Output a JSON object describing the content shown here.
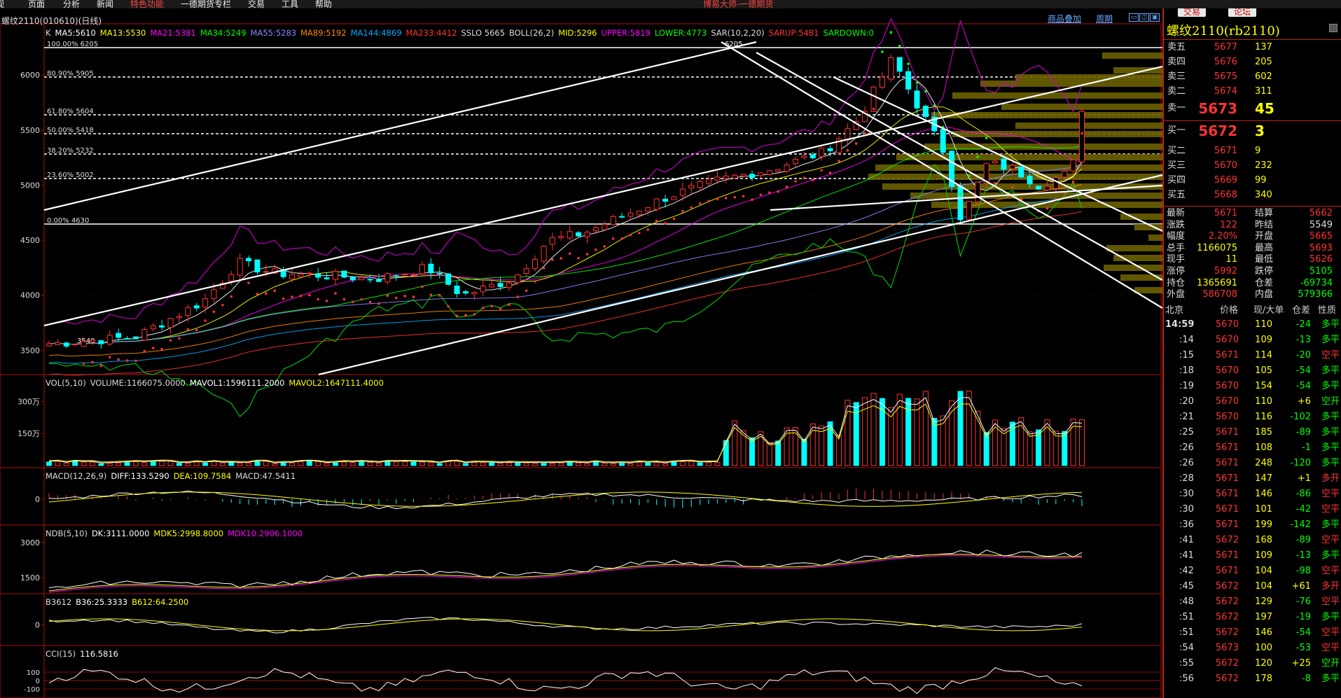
{
  "menu": {
    "items": [
      "视",
      "页面",
      "分析",
      "新闻",
      "特色功能",
      "一德期货专栏",
      "交易",
      "工具",
      "帮助"
    ],
    "app_title": "博易大师-一德期货"
  },
  "chart": {
    "symbol_title": "螺纹2110(010610)(日线)",
    "links": [
      "商品叠加",
      "周期"
    ],
    "main_indicators": [
      {
        "t": "K",
        "c": "#ddd"
      },
      {
        "t": "MA5:5610",
        "c": "#fff"
      },
      {
        "t": "MA13:5530",
        "c": "#ff0"
      },
      {
        "t": "MA21:5381",
        "c": "#f0f"
      },
      {
        "t": "MA34:5249",
        "c": "#0f0"
      },
      {
        "t": "MA55:5283",
        "c": "#88f"
      },
      {
        "t": "MA89:5192",
        "c": "#f80"
      },
      {
        "t": "MA144:4869",
        "c": "#0af"
      },
      {
        "t": "MA233:4412",
        "c": "#f33"
      },
      {
        "t": "SSLO 5665",
        "c": "#ddd"
      },
      {
        "t": "BOLL(26,2)",
        "c": "#ddd"
      },
      {
        "t": "MID:5296",
        "c": "#ff0"
      },
      {
        "t": "UPPER:5819",
        "c": "#f0f"
      },
      {
        "t": "LOWER:4773",
        "c": "#0f0"
      },
      {
        "t": "SAR(10,2,20)",
        "c": "#ddd"
      },
      {
        "t": "SARUP:5481",
        "c": "#f33"
      },
      {
        "t": "SARDOWN:0",
        "c": "#0f0"
      }
    ],
    "main_y_ticks": [
      "6000",
      "5500",
      "5000",
      "4500",
      "4000",
      "3500"
    ],
    "fib_labels": [
      "100.00% 6205",
      "80.90% 5905",
      "61.80% 5604",
      "50.00% 5418",
      "38.20% 5232",
      "23.60% 5002",
      "0.00% 4630"
    ],
    "peak_label": "6205",
    "low_label": "3540",
    "vol": {
      "title": "VOL(5,10)",
      "items": [
        {
          "t": "VOLUME:1166075.0000",
          "c": "#ddd"
        },
        {
          "t": "MAVOL1:1596111.2000",
          "c": "#fff"
        },
        {
          "t": "MAVOL2:1647111.4000",
          "c": "#ff0"
        }
      ],
      "ticks": [
        "300万",
        "150万"
      ]
    },
    "macd": {
      "title": "MACD(12,26,9)",
      "items": [
        {
          "t": "DIFF:133.5290",
          "c": "#fff"
        },
        {
          "t": "DEA:109.7584",
          "c": "#ff0"
        },
        {
          "t": "MACD:47.5411",
          "c": "#ddd"
        }
      ],
      "ticks": [
        "0"
      ]
    },
    "ndb": {
      "title": "NDB(5,10)",
      "items": [
        {
          "t": "DK:3111.0000",
          "c": "#fff"
        },
        {
          "t": "MDK5:2998.8000",
          "c": "#ff0"
        },
        {
          "t": "MDK10:2906.1000",
          "c": "#f0f"
        }
      ],
      "ticks": [
        "3000",
        "1500"
      ]
    },
    "b3612": {
      "title": "B3612",
      "items": [
        {
          "t": "B36:25.3333",
          "c": "#fff"
        },
        {
          "t": "B612:64.2500",
          "c": "#ff0"
        }
      ],
      "ticks": [
        "0"
      ]
    },
    "cci": {
      "title": "CCI(15)",
      "items": [
        {
          "t": "116.5816",
          "c": "#fff"
        }
      ],
      "ticks": [
        "100",
        "0",
        "-100"
      ]
    }
  },
  "panel": {
    "buttons": [
      "交易",
      "论坛"
    ],
    "title": "螺纹2110(rb2110)",
    "asks": [
      {
        "l": "卖五",
        "p": "5677",
        "v": "137"
      },
      {
        "l": "卖四",
        "p": "5676",
        "v": "205"
      },
      {
        "l": "卖三",
        "p": "5675",
        "v": "602"
      },
      {
        "l": "卖二",
        "p": "5674",
        "v": "311"
      }
    ],
    "ask1": {
      "l": "卖一",
      "p": "5673",
      "v": "45"
    },
    "bid1": {
      "l": "买一",
      "p": "5672",
      "v": "3"
    },
    "bids": [
      {
        "l": "买二",
        "p": "5671",
        "v": "9"
      },
      {
        "l": "买三",
        "p": "5670",
        "v": "232"
      },
      {
        "l": "买四",
        "p": "5669",
        "v": "99"
      },
      {
        "l": "买五",
        "p": "5668",
        "v": "340"
      }
    ],
    "stats": [
      {
        "l1": "最新",
        "v1": "5671",
        "c1": "#f33",
        "l2": "结算",
        "v2": "5662",
        "c2": "#f33"
      },
      {
        "l1": "涨跌",
        "v1": "122",
        "c1": "#f33",
        "l2": "昨结",
        "v2": "5549",
        "c2": "#ddd"
      },
      {
        "l1": "幅度",
        "v1": "2.20%",
        "c1": "#f33",
        "l2": "开盘",
        "v2": "5665",
        "c2": "#f33"
      },
      {
        "l1": "总手",
        "v1": "1166075",
        "c1": "#ff0",
        "l2": "最高",
        "v2": "5693",
        "c2": "#f33"
      },
      {
        "l1": "现手",
        "v1": "11",
        "c1": "#ff0",
        "l2": "最低",
        "v2": "5626",
        "c2": "#f33"
      },
      {
        "l1": "涨停",
        "v1": "5992",
        "c1": "#f33",
        "l2": "跌停",
        "v2": "5105",
        "c2": "#0f0"
      },
      {
        "l1": "持仓",
        "v1": "1365691",
        "c1": "#ff0",
        "l2": "仓差",
        "v2": "-69734",
        "c2": "#0f0"
      },
      {
        "l1": "外盘",
        "v1": "586708",
        "c1": "#f33",
        "l2": "内盘",
        "v2": "579366",
        "c2": "#0f0"
      }
    ],
    "tick_header": [
      "北京",
      "价格",
      "现/大单",
      "仓差",
      "性质"
    ],
    "ticks": [
      {
        "t": "14:59",
        "p": "5670",
        "v": "110",
        "d": "-24",
        "n": "多平",
        "dc": "#0f0",
        "nc": "#0f0"
      },
      {
        "t": ":14",
        "p": "5670",
        "v": "109",
        "d": "-13",
        "n": "多平",
        "dc": "#0f0",
        "nc": "#0f0"
      },
      {
        "t": ":15",
        "p": "5671",
        "v": "114",
        "d": "-20",
        "n": "空平",
        "dc": "#0f0",
        "nc": "#f33"
      },
      {
        "t": ":18",
        "p": "5670",
        "v": "105",
        "d": "-54",
        "n": "多平",
        "dc": "#0f0",
        "nc": "#0f0"
      },
      {
        "t": ":19",
        "p": "5670",
        "v": "154",
        "d": "-54",
        "n": "多平",
        "dc": "#0f0",
        "nc": "#0f0"
      },
      {
        "t": ":20",
        "p": "5670",
        "v": "110",
        "d": "+6",
        "n": "空开",
        "dc": "#ff0",
        "nc": "#0f0"
      },
      {
        "t": ":21",
        "p": "5670",
        "v": "116",
        "d": "-102",
        "n": "多平",
        "dc": "#0f0",
        "nc": "#0f0"
      },
      {
        "t": ":25",
        "p": "5671",
        "v": "185",
        "d": "-89",
        "n": "多平",
        "dc": "#0f0",
        "nc": "#0f0"
      },
      {
        "t": ":26",
        "p": "5671",
        "v": "108",
        "d": "-1",
        "n": "多平",
        "dc": "#0f0",
        "nc": "#0f0"
      },
      {
        "t": ":26",
        "p": "5671",
        "v": "248",
        "d": "-120",
        "n": "多平",
        "dc": "#0f0",
        "nc": "#0f0"
      },
      {
        "t": ":28",
        "p": "5671",
        "v": "147",
        "d": "+1",
        "n": "多开",
        "dc": "#ff0",
        "nc": "#f33"
      },
      {
        "t": ":30",
        "p": "5671",
        "v": "146",
        "d": "-86",
        "n": "空平",
        "dc": "#0f0",
        "nc": "#f33"
      },
      {
        "t": ":30",
        "p": "5671",
        "v": "101",
        "d": "-42",
        "n": "空平",
        "dc": "#0f0",
        "nc": "#f33"
      },
      {
        "t": ":36",
        "p": "5671",
        "v": "199",
        "d": "-142",
        "n": "多平",
        "dc": "#0f0",
        "nc": "#0f0"
      },
      {
        "t": ":41",
        "p": "5672",
        "v": "168",
        "d": "-89",
        "n": "空平",
        "dc": "#0f0",
        "nc": "#f33"
      },
      {
        "t": ":41",
        "p": "5671",
        "v": "109",
        "d": "-13",
        "n": "多平",
        "dc": "#0f0",
        "nc": "#0f0"
      },
      {
        "t": ":42",
        "p": "5671",
        "v": "104",
        "d": "-98",
        "n": "空平",
        "dc": "#0f0",
        "nc": "#f33"
      },
      {
        "t": ":45",
        "p": "5672",
        "v": "104",
        "d": "+61",
        "n": "多开",
        "dc": "#ff0",
        "nc": "#f33"
      },
      {
        "t": ":48",
        "p": "5672",
        "v": "129",
        "d": "-76",
        "n": "空平",
        "dc": "#0f0",
        "nc": "#f33"
      },
      {
        "t": ":51",
        "p": "5672",
        "v": "197",
        "d": "-19",
        "n": "多平",
        "dc": "#0f0",
        "nc": "#0f0"
      },
      {
        "t": ":51",
        "p": "5672",
        "v": "146",
        "d": "-54",
        "n": "空平",
        "dc": "#0f0",
        "nc": "#f33"
      },
      {
        "t": ":54",
        "p": "5673",
        "v": "100",
        "d": "-53",
        "n": "空平",
        "dc": "#0f0",
        "nc": "#f33"
      },
      {
        "t": ":55",
        "p": "5672",
        "v": "120",
        "d": "+25",
        "n": "空开",
        "dc": "#ff0",
        "nc": "#0f0"
      },
      {
        "t": ":56",
        "p": "5672",
        "v": "178",
        "d": "-8",
        "n": "多平",
        "dc": "#0f0",
        "nc": "#0f0"
      }
    ]
  }
}
